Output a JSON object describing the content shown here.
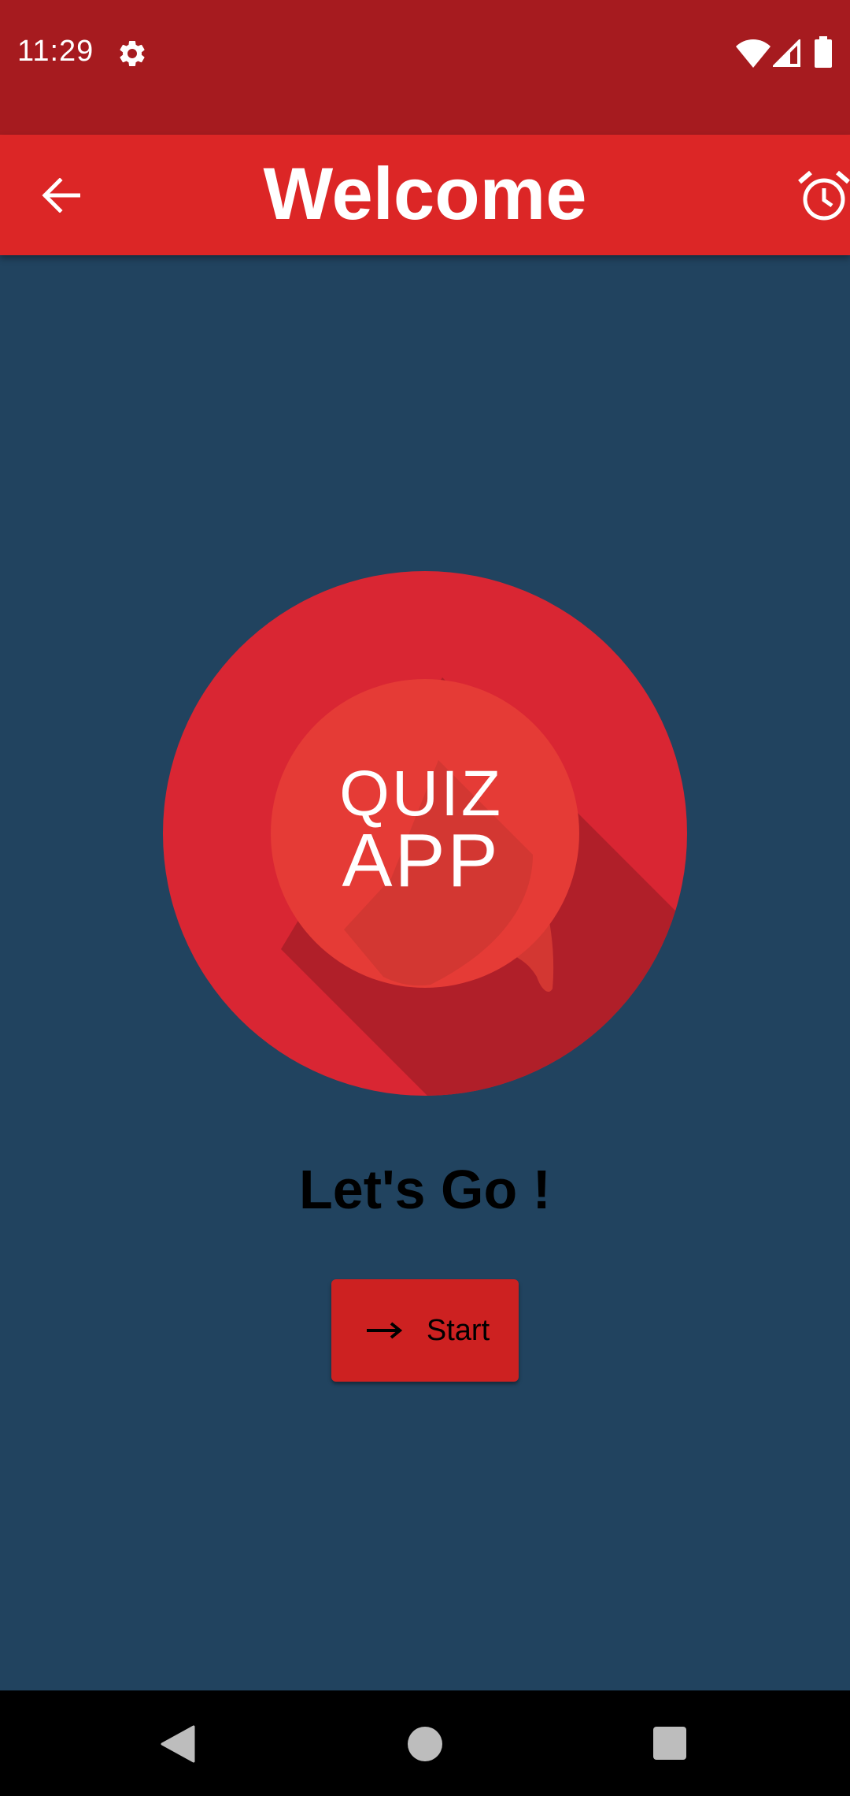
{
  "status_bar": {
    "time": "11:29",
    "icons": [
      "gear-icon",
      "wifi-icon",
      "signal-icon",
      "battery-icon"
    ]
  },
  "app_bar": {
    "title": "Welcome",
    "back_icon": "arrow-back-icon",
    "action_icon": "alarm-clock-icon"
  },
  "logo": {
    "line1": "QUIZ",
    "line2": "APP"
  },
  "main": {
    "greeting": "Let's Go !",
    "start_button": {
      "label": "Start",
      "icon": "arrow-right-icon"
    }
  },
  "nav_bar": {
    "icons": [
      "nav-back-icon",
      "nav-home-icon",
      "nav-recents-icon"
    ]
  },
  "colors": {
    "status_bar": "#a61b1f",
    "app_bar": "#dc2626",
    "background": "#21435f",
    "logo_outer": "#d92633",
    "logo_inner": "#e53935",
    "button": "#cd2121"
  }
}
